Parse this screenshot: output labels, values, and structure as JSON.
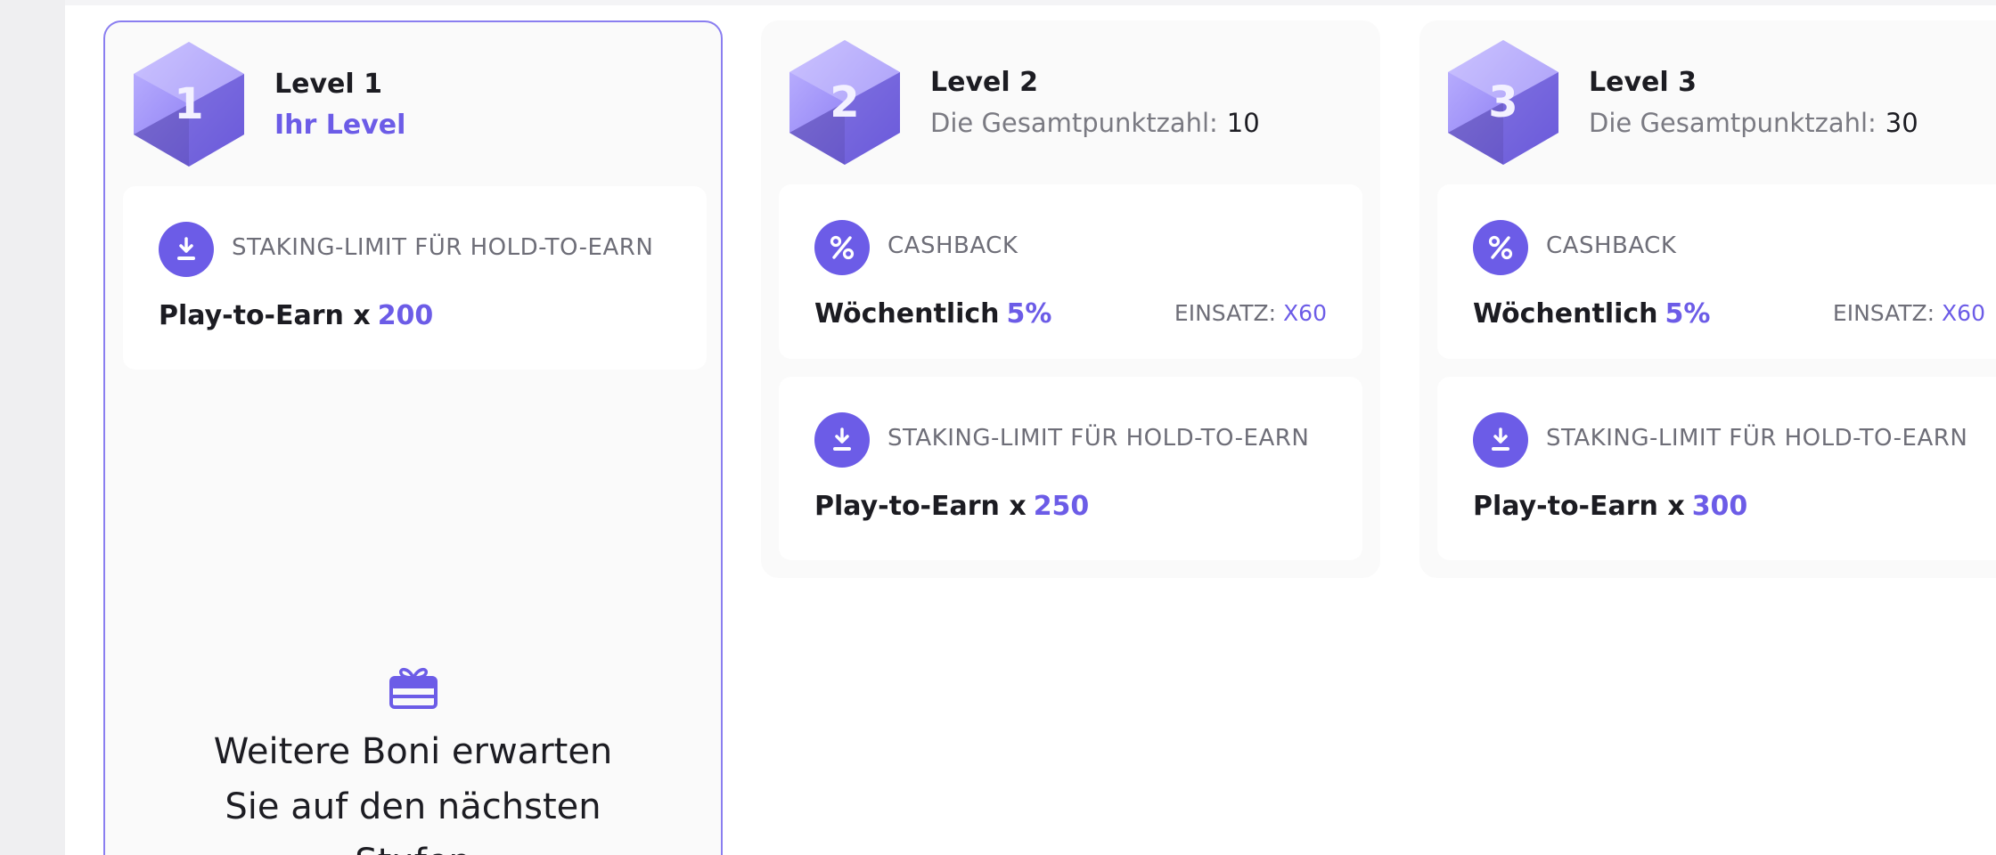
{
  "colors": {
    "accent": "#6c5ce7",
    "card_bg": "#fafafa",
    "bonus_bg": "#ffffff",
    "current_border": "#8a7ef0"
  },
  "levels": [
    {
      "number": "1",
      "title": "Level 1",
      "subtitle": "Ihr Level",
      "is_current": true,
      "staking": {
        "label": "STAKING-LIMIT FÜR HOLD-TO-EARN",
        "value_prefix": "Play-to-Earn x",
        "value": "200",
        "icon": "download-icon"
      },
      "more_bonuses": {
        "icon": "gift-icon",
        "text": "Weitere Boni erwarten Sie auf den nächsten Stufen"
      }
    },
    {
      "number": "2",
      "title": "Level 2",
      "points_label": "Die Gesamtpunktzahl:",
      "points": "10",
      "is_current": false,
      "cashback": {
        "label": "CASHBACK",
        "value_prefix": "Wöchentlich",
        "value": "5%",
        "bet_label": "EINSATZ:",
        "bet_value": "X60",
        "icon": "percent-icon"
      },
      "staking": {
        "label": "STAKING-LIMIT FÜR HOLD-TO-EARN",
        "value_prefix": "Play-to-Earn x",
        "value": "250",
        "icon": "download-icon"
      }
    },
    {
      "number": "3",
      "title": "Level 3",
      "points_label": "Die Gesamtpunktzahl:",
      "points": "30",
      "is_current": false,
      "cashback": {
        "label": "CASHBACK",
        "value_prefix": "Wöchentlich",
        "value": "5%",
        "bet_label": "EINSATZ:",
        "bet_value": "X60",
        "icon": "percent-icon"
      },
      "staking": {
        "label": "STAKING-LIMIT FÜR HOLD-TO-EARN",
        "value_prefix": "Play-to-Earn x",
        "value": "300",
        "icon": "download-icon"
      }
    }
  ]
}
